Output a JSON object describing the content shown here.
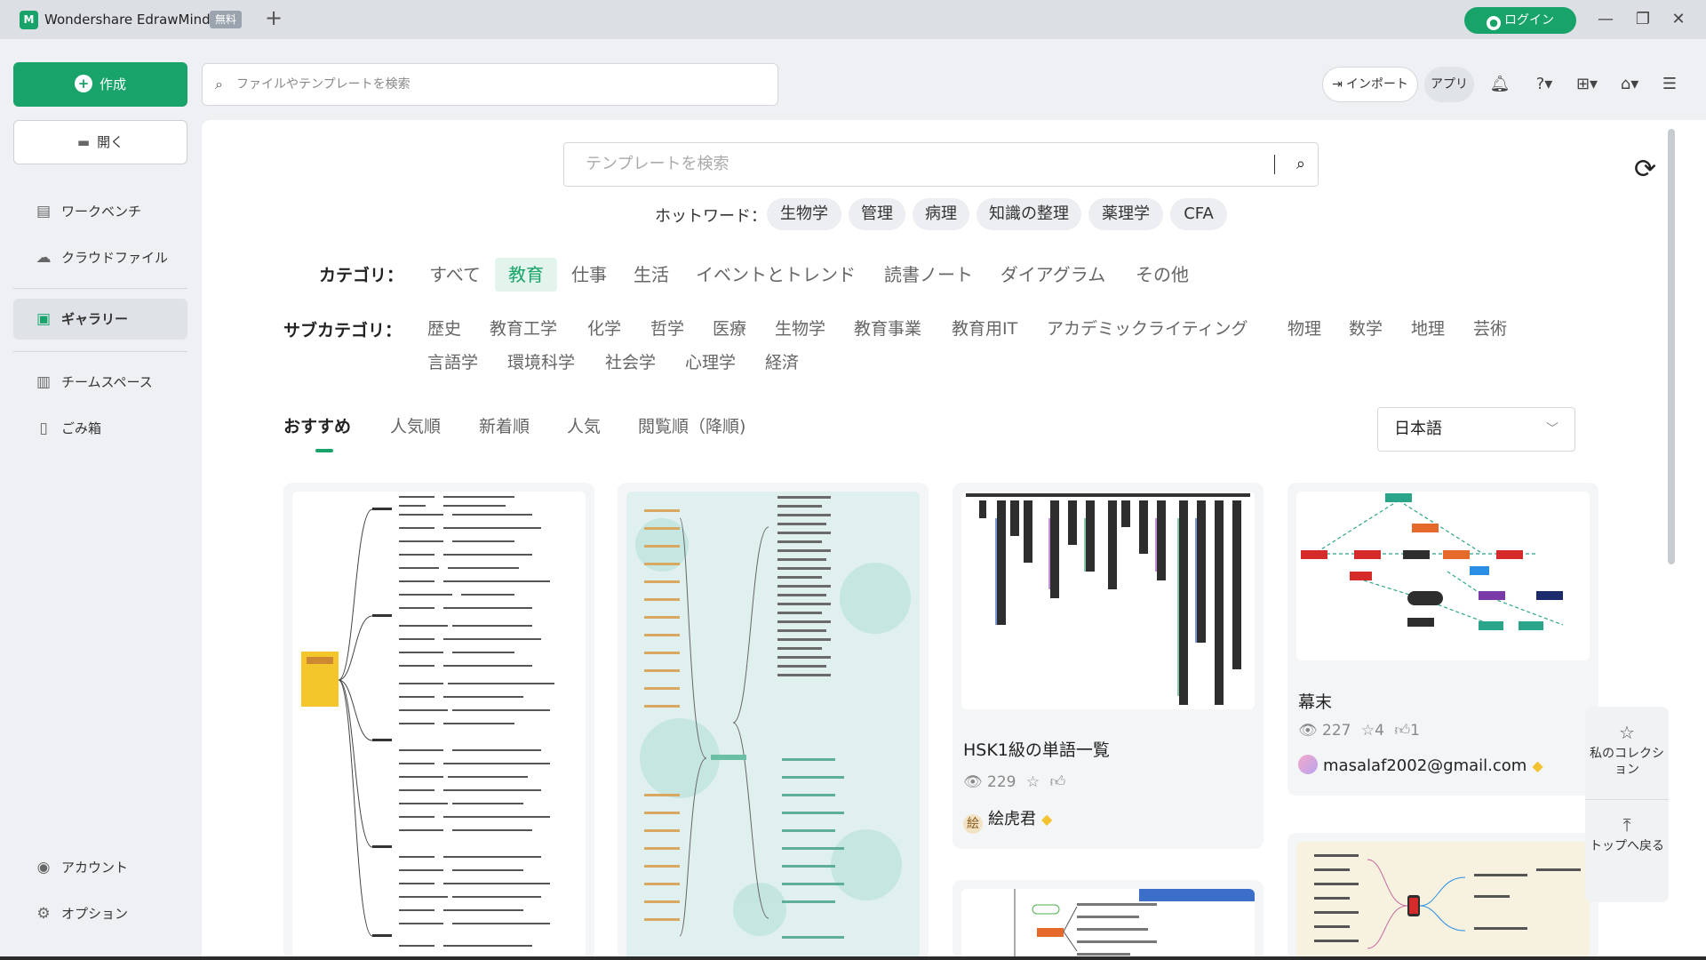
{
  "app": {
    "title": "Wondershare EdrawMind",
    "free_badge": "無料",
    "new_tab": "+",
    "login": "ログイン",
    "win_min": "—",
    "win_restore": "❐",
    "win_close": "✕"
  },
  "sidebar": {
    "create": "作成",
    "open": "開く",
    "items": [
      {
        "label": "ワークベンチ",
        "icon": "workbench-icon"
      },
      {
        "label": "クラウドファイル",
        "icon": "cloud-icon"
      },
      {
        "label": "ギャラリー",
        "icon": "gallery-icon"
      },
      {
        "label": "チームスペース",
        "icon": "team-space-icon"
      },
      {
        "label": "ごみ箱",
        "icon": "trash-icon"
      }
    ],
    "account": "アカウント",
    "options": "オプション"
  },
  "toolbar": {
    "search_placeholder": "ファイルやテンプレートを検索",
    "import": "インポート",
    "apps": "アプリ"
  },
  "gallery": {
    "search_placeholder": "テンプレートを検索",
    "hot_label": "ホットワード：",
    "hot_words": [
      "生物学",
      "管理",
      "病理",
      "知識の整理",
      "薬理学",
      "CFA"
    ],
    "category_label": "カテゴリ：",
    "categories": [
      "すべて",
      "教育",
      "仕事",
      "生活",
      "イベントとトレンド",
      "読書ノート",
      "ダイアグラム",
      "その他"
    ],
    "active_category": "教育",
    "subcategory_label": "サブカテゴリ：",
    "subcategories_row1": [
      "歴史",
      "教育工学",
      "化学",
      "哲学",
      "医療",
      "生物学",
      "教育事業",
      "教育用IT",
      "アカデミックライティング",
      "物理",
      "数学",
      "地理",
      "芸術"
    ],
    "subcategories_row2": [
      "言語学",
      "環境科学",
      "社会学",
      "心理学",
      "経済"
    ],
    "sort_tabs": [
      "おすすめ",
      "人気順",
      "新着順",
      "人気",
      "閲覧順（降順)"
    ],
    "active_sort": "おすすめ",
    "language": "日本語"
  },
  "cards": {
    "c3": {
      "title": "HSK1級の単語一覧",
      "views": "229",
      "author": "絵虎君",
      "avatar_char": "絵"
    },
    "c4": {
      "title": "幕末",
      "views": "227",
      "stars": "4",
      "likes": "1",
      "author": "masalaf2002@gmail.com"
    }
  },
  "float": {
    "collection": "私のコレクション",
    "to_top": "トップへ戻る"
  },
  "colors": {
    "accent": "#18a36a",
    "titlebar": "#dcdfe4",
    "sidebar_bg": "#eef0f3"
  }
}
